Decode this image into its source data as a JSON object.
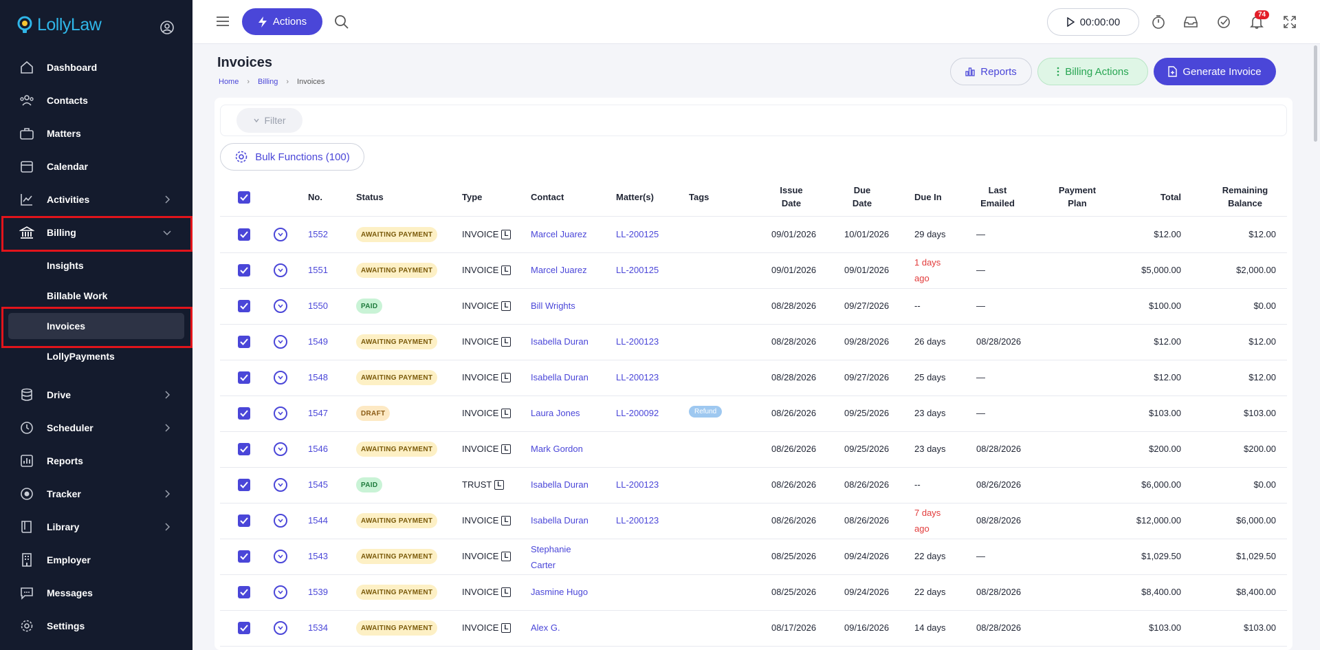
{
  "brand": {
    "name": "LollyLaw"
  },
  "sidebar": {
    "items": [
      {
        "label": "Dashboard",
        "icon": "home-icon"
      },
      {
        "label": "Contacts",
        "icon": "contacts-icon"
      },
      {
        "label": "Matters",
        "icon": "briefcase-icon"
      },
      {
        "label": "Calendar",
        "icon": "calendar-icon"
      },
      {
        "label": "Activities",
        "icon": "chart-icon"
      },
      {
        "label": "Billing",
        "icon": "bank-icon"
      },
      {
        "label": "Drive",
        "icon": "database-icon"
      },
      {
        "label": "Scheduler",
        "icon": "clock-icon"
      },
      {
        "label": "Reports",
        "icon": "bar-chart-icon"
      },
      {
        "label": "Tracker",
        "icon": "target-icon"
      },
      {
        "label": "Library",
        "icon": "book-icon"
      },
      {
        "label": "Employer",
        "icon": "building-icon"
      },
      {
        "label": "Messages",
        "icon": "message-icon"
      },
      {
        "label": "Settings",
        "icon": "gear-icon"
      }
    ],
    "billing_sub": [
      {
        "label": "Insights"
      },
      {
        "label": "Billable Work"
      },
      {
        "label": "Invoices"
      },
      {
        "label": "LollyPayments"
      }
    ]
  },
  "topbar": {
    "actions_label": "Actions",
    "timer": "00:00:00",
    "notifications_count": "74"
  },
  "page": {
    "title": "Invoices",
    "breadcrumb": [
      "Home",
      "Billing",
      "Invoices"
    ],
    "reports_label": "Reports",
    "billing_actions_label": "Billing Actions",
    "generate_label": "Generate Invoice",
    "filter_label": "Filter",
    "bulk_label": "Bulk Functions (100)"
  },
  "table": {
    "headers": {
      "no": "No.",
      "status": "Status",
      "type": "Type",
      "contact": "Contact",
      "matters": "Matter(s)",
      "tags": "Tags",
      "issue_1": "Issue",
      "issue_2": "Date",
      "due_1": "Due",
      "due_2": "Date",
      "due_in": "Due In",
      "last_1": "Last",
      "last_2": "Emailed",
      "plan_1": "Payment",
      "plan_2": "Plan",
      "total": "Total",
      "rem_1": "Remaining",
      "rem_2": "Balance"
    },
    "rows": [
      {
        "no": "1552",
        "status": "AWAITING PAYMENT",
        "type": "INVOICE",
        "contact": "Marcel Juarez",
        "matter": "LL-200125",
        "tag": "",
        "issue": "09/01/2026",
        "due": "10/01/2026",
        "due_in": "29 days",
        "late": false,
        "emailed": "—",
        "total": "$12.00",
        "balance": "$12.00"
      },
      {
        "no": "1551",
        "status": "AWAITING PAYMENT",
        "type": "INVOICE",
        "contact": "Marcel Juarez",
        "matter": "LL-200125",
        "tag": "",
        "issue": "09/01/2026",
        "due": "09/01/2026",
        "due_in": "1 days ago",
        "late": true,
        "emailed": "—",
        "total": "$5,000.00",
        "balance": "$2,000.00"
      },
      {
        "no": "1550",
        "status": "PAID",
        "type": "INVOICE",
        "contact": "Bill Wrights",
        "matter": "",
        "tag": "",
        "issue": "08/28/2026",
        "due": "09/27/2026",
        "due_in": "--",
        "late": false,
        "emailed": "—",
        "total": "$100.00",
        "balance": "$0.00"
      },
      {
        "no": "1549",
        "status": "AWAITING PAYMENT",
        "type": "INVOICE",
        "contact": "Isabella Duran",
        "matter": "LL-200123",
        "tag": "",
        "issue": "08/28/2026",
        "due": "09/28/2026",
        "due_in": "26 days",
        "late": false,
        "emailed": "08/28/2026",
        "total": "$12.00",
        "balance": "$12.00"
      },
      {
        "no": "1548",
        "status": "AWAITING PAYMENT",
        "type": "INVOICE",
        "contact": "Isabella Duran",
        "matter": "LL-200123",
        "tag": "",
        "issue": "08/28/2026",
        "due": "09/27/2026",
        "due_in": "25 days",
        "late": false,
        "emailed": "—",
        "total": "$12.00",
        "balance": "$12.00"
      },
      {
        "no": "1547",
        "status": "DRAFT",
        "type": "INVOICE",
        "contact": "Laura Jones",
        "matter": "LL-200092",
        "tag": "Refund",
        "issue": "08/26/2026",
        "due": "09/25/2026",
        "due_in": "23 days",
        "late": false,
        "emailed": "—",
        "total": "$103.00",
        "balance": "$103.00"
      },
      {
        "no": "1546",
        "status": "AWAITING PAYMENT",
        "type": "INVOICE",
        "contact": "Mark Gordon",
        "matter": "",
        "tag": "",
        "issue": "08/26/2026",
        "due": "09/25/2026",
        "due_in": "23 days",
        "late": false,
        "emailed": "08/28/2026",
        "total": "$200.00",
        "balance": "$200.00"
      },
      {
        "no": "1545",
        "status": "PAID",
        "type": "TRUST",
        "contact": "Isabella Duran",
        "matter": "LL-200123",
        "tag": "",
        "issue": "08/26/2026",
        "due": "08/26/2026",
        "due_in": "--",
        "late": false,
        "emailed": "08/26/2026",
        "total": "$6,000.00",
        "balance": "$0.00"
      },
      {
        "no": "1544",
        "status": "AWAITING PAYMENT",
        "type": "INVOICE",
        "contact": "Isabella Duran",
        "matter": "LL-200123",
        "tag": "",
        "issue": "08/26/2026",
        "due": "08/26/2026",
        "due_in": "7 days ago",
        "late": true,
        "emailed": "08/28/2026",
        "total": "$12,000.00",
        "balance": "$6,000.00"
      },
      {
        "no": "1543",
        "status": "AWAITING PAYMENT",
        "type": "INVOICE",
        "contact": "Stephanie Carter",
        "matter": "",
        "tag": "",
        "issue": "08/25/2026",
        "due": "09/24/2026",
        "due_in": "22 days",
        "late": false,
        "emailed": "—",
        "total": "$1,029.50",
        "balance": "$1,029.50"
      },
      {
        "no": "1539",
        "status": "AWAITING PAYMENT",
        "type": "INVOICE",
        "contact": "Jasmine Hugo",
        "matter": "",
        "tag": "",
        "issue": "08/25/2026",
        "due": "09/24/2026",
        "due_in": "22 days",
        "late": false,
        "emailed": "08/28/2026",
        "total": "$8,400.00",
        "balance": "$8,400.00"
      },
      {
        "no": "1534",
        "status": "AWAITING PAYMENT",
        "type": "INVOICE",
        "contact": "Alex G.",
        "matter": "",
        "tag": "",
        "issue": "08/17/2026",
        "due": "09/16/2026",
        "due_in": "14 days",
        "late": false,
        "emailed": "08/28/2026",
        "total": "$103.00",
        "balance": "$103.00"
      }
    ]
  }
}
